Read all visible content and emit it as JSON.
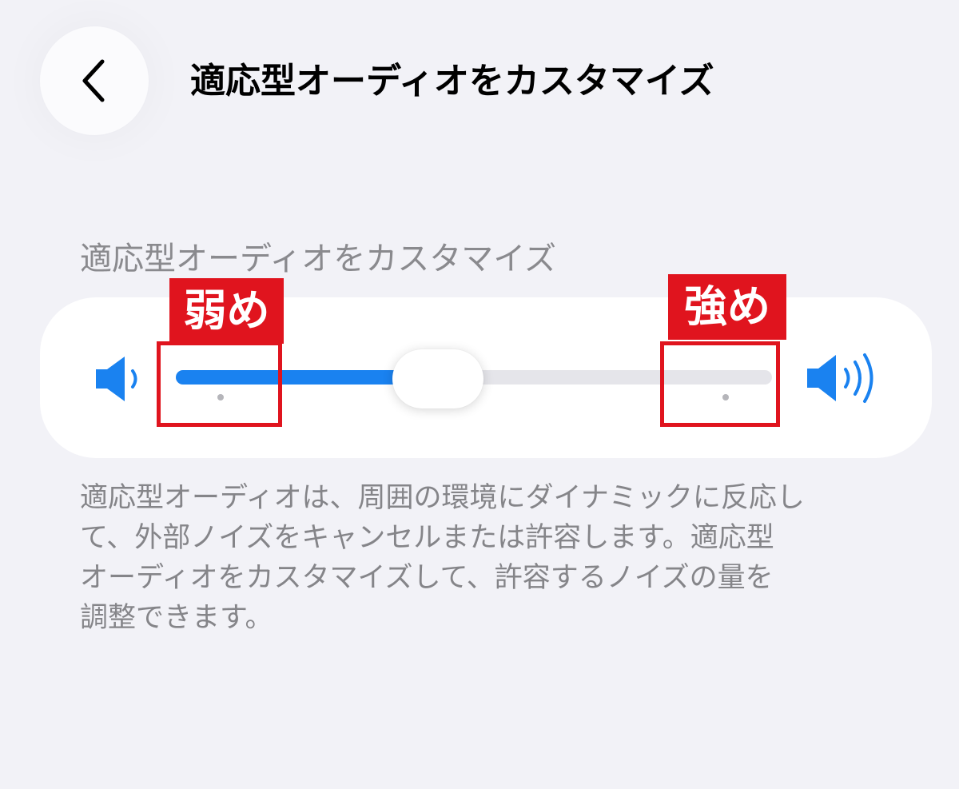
{
  "header": {
    "title": "適応型オーディオをカスタマイズ",
    "back_icon": "chevron-left-icon"
  },
  "section": {
    "header": "適応型オーディオをカスタマイズ"
  },
  "slider": {
    "value_fraction": 0.44,
    "min_icon": "speaker-low-icon",
    "max_icon": "speaker-high-icon",
    "accent_color": "#1a82f0"
  },
  "annotations": {
    "left_label": "弱め",
    "right_label": "強め",
    "color": "#e0141e"
  },
  "description": "適応型オーディオは、周囲の環境にダイナミックに反応し\nて、外部ノイズをキャンセルまたは許容します。適応型\nオーディオをカスタマイズして、許容するノイズの量を\n調整できます。"
}
